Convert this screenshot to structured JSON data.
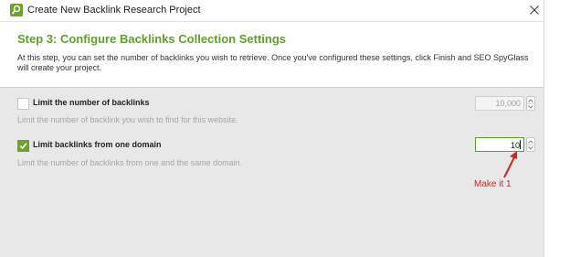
{
  "window": {
    "title": "Create New Backlink Research Project",
    "close_label": "close"
  },
  "step": {
    "title": "Step 3: Configure Backlinks Collection Settings",
    "description": "At this step, you can set the number of backlinks you wish to retrieve. Once you've configured these settings, click Finish and SEO SpyGlass will create your project."
  },
  "options": [
    {
      "label": "Limit the number of backlinks",
      "description": "Limit the number of backlink you wish to find for this website.",
      "checked": false,
      "value": "10,000",
      "enabled": false
    },
    {
      "label": "Limit backlinks from one domain",
      "description": "Limit the number of backlinks from one and the same domain.",
      "checked": true,
      "value": "10",
      "enabled": true
    }
  ],
  "annotation": {
    "text": "Make it 1",
    "color": "#d22525"
  },
  "colors": {
    "accent": "#6aa428",
    "title_green": "#5fa02d",
    "panel_bg": "#e8e8e8"
  }
}
